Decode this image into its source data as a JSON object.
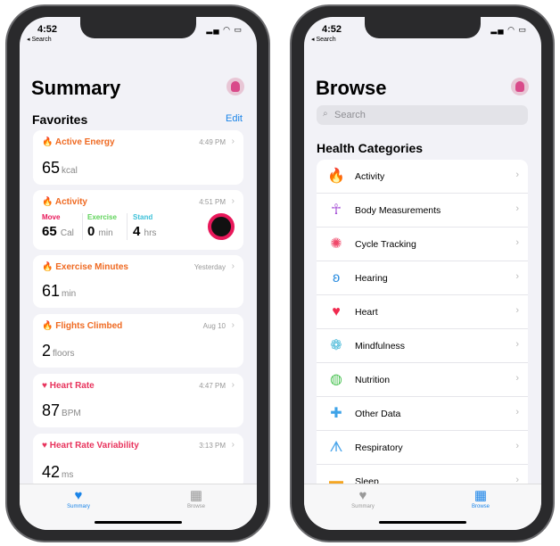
{
  "status": {
    "time": "4:52",
    "back": "◂ Search"
  },
  "summary": {
    "title": "Summary",
    "favorites": "Favorites",
    "edit": "Edit",
    "cards": [
      {
        "title": "Active Energy",
        "time": "4:49 PM",
        "value": "65",
        "unit": "kcal",
        "icon": "flame-icon"
      },
      {
        "title": "Activity",
        "time": "4:51 PM",
        "move_label": "Move",
        "move": "65",
        "move_unit": "Cal",
        "exercise_label": "Exercise",
        "exercise": "0",
        "exercise_unit": "min",
        "stand_label": "Stand",
        "stand": "4",
        "stand_unit": "hrs"
      },
      {
        "title": "Exercise Minutes",
        "time": "Yesterday",
        "value": "61",
        "unit": "min"
      },
      {
        "title": "Flights Climbed",
        "time": "Aug 10",
        "value": "2",
        "unit": "floors"
      },
      {
        "title": "Heart Rate",
        "time": "4:47 PM",
        "value": "87",
        "unit": "BPM"
      },
      {
        "title": "Heart Rate Variability",
        "time": "3:13 PM",
        "value": "42",
        "unit": "ms"
      }
    ]
  },
  "browse": {
    "title": "Browse",
    "search_placeholder": "Search",
    "section": "Health Categories",
    "categories": [
      {
        "label": "Activity",
        "icon": "flame-icon",
        "color": "#f5661e"
      },
      {
        "label": "Body Measurements",
        "icon": "person-icon",
        "color": "#a550d6"
      },
      {
        "label": "Cycle Tracking",
        "icon": "cycle-icon",
        "color": "#f0486a"
      },
      {
        "label": "Hearing",
        "icon": "ear-icon",
        "color": "#2f8fe0"
      },
      {
        "label": "Heart",
        "icon": "heart-icon",
        "color": "#f0294e"
      },
      {
        "label": "Mindfulness",
        "icon": "flower-icon",
        "color": "#45b8d8"
      },
      {
        "label": "Nutrition",
        "icon": "apple-icon",
        "color": "#4cc354"
      },
      {
        "label": "Other Data",
        "icon": "plus-icon",
        "color": "#3ea3e8"
      },
      {
        "label": "Respiratory",
        "icon": "lungs-icon",
        "color": "#4aa5ea"
      },
      {
        "label": "Sleep",
        "icon": "bed-icon",
        "color": "#f5a623"
      }
    ]
  },
  "tabs": {
    "summary": "Summary",
    "browse": "Browse"
  },
  "colors": {
    "accent": "#1a84e8",
    "orange": "#ef6a22",
    "pink": "#e8345d",
    "move": "#e8185a",
    "exercise": "#5fd35a",
    "stand": "#3cc0d8"
  }
}
